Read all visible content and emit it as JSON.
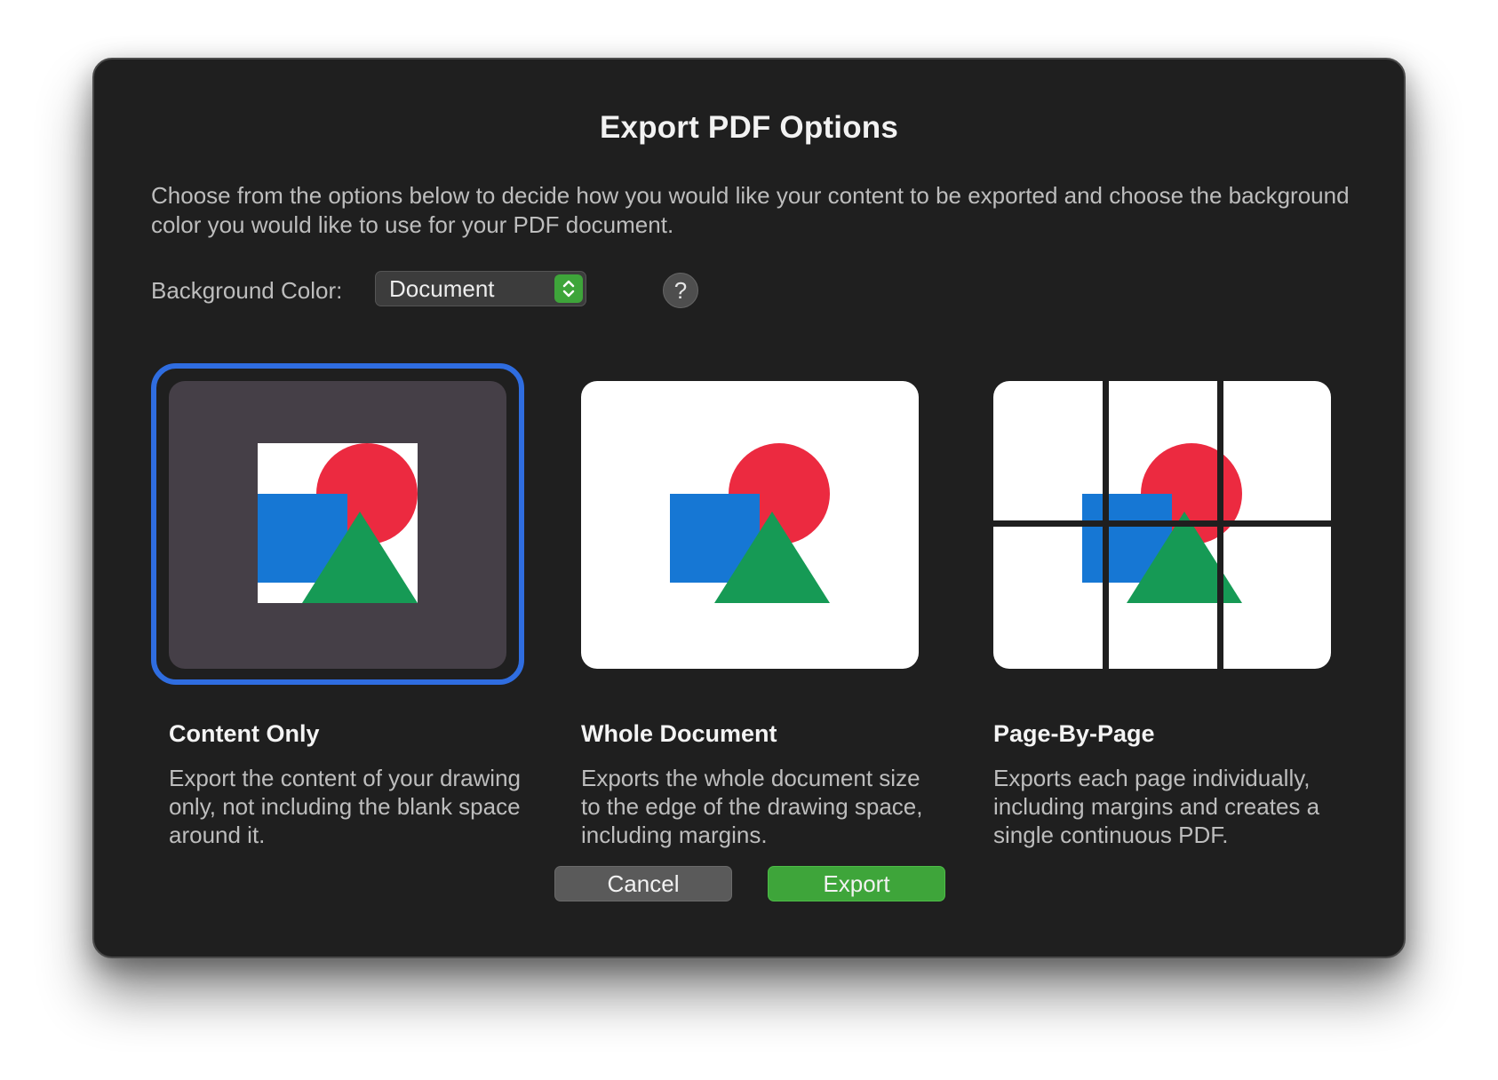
{
  "dialog": {
    "title": "Export PDF Options",
    "description": "Choose from the options below to decide how you would like your content to be exported and choose the background color you would like to use for your PDF document."
  },
  "background_color": {
    "label": "Background Color:",
    "selected": "Document",
    "help_glyph": "?"
  },
  "options": [
    {
      "title": "Content Only",
      "description": "Export the content of your drawing only, not including the blank space around it.",
      "selected": true
    },
    {
      "title": "Whole Document",
      "description": "Exports the whole document size to the edge of the drawing space, including margins.",
      "selected": false
    },
    {
      "title": "Page-By-Page",
      "description": "Exports each page individually, including margins and creates a single continuous PDF.",
      "selected": false
    }
  ],
  "buttons": {
    "cancel": "Cancel",
    "export": "Export"
  },
  "colors": {
    "accent": "#2f6de0",
    "export_button": "#3ea53a",
    "shape_red": "#ec2a40",
    "shape_blue": "#1677d4",
    "shape_green": "#169a55"
  },
  "icons": {
    "stepper": "up-down-chevron-icon",
    "help": "question-mark-icon"
  }
}
